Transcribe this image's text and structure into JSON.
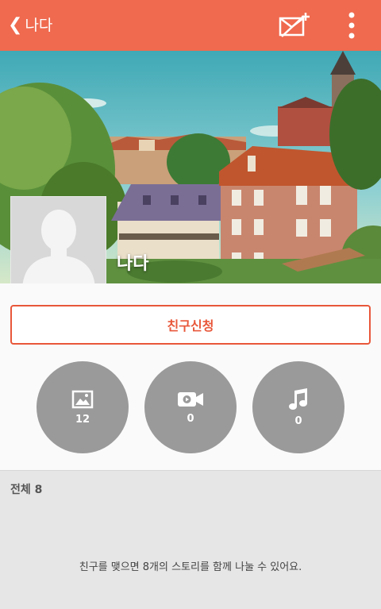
{
  "appbar": {
    "back_icon": "chevron-left-icon",
    "title": "나다",
    "actions": [
      {
        "icon": "no-ticket-add-icon"
      },
      {
        "icon": "more-vertical-icon"
      }
    ],
    "color": "#ef6a4f"
  },
  "profile": {
    "name": "나다",
    "avatar_icon": "default-avatar-silhouette"
  },
  "friend_request": {
    "label": "친구신청",
    "accent_color": "#e8573a"
  },
  "media": [
    {
      "icon": "photo-icon",
      "count": "12"
    },
    {
      "icon": "video-icon",
      "count": "0"
    },
    {
      "icon": "music-note-icon",
      "count": "0"
    }
  ],
  "stories": {
    "title": "전체 8",
    "message": "친구를 맺으면 8개의 스토리를 함께 나눌 수 있어요."
  }
}
